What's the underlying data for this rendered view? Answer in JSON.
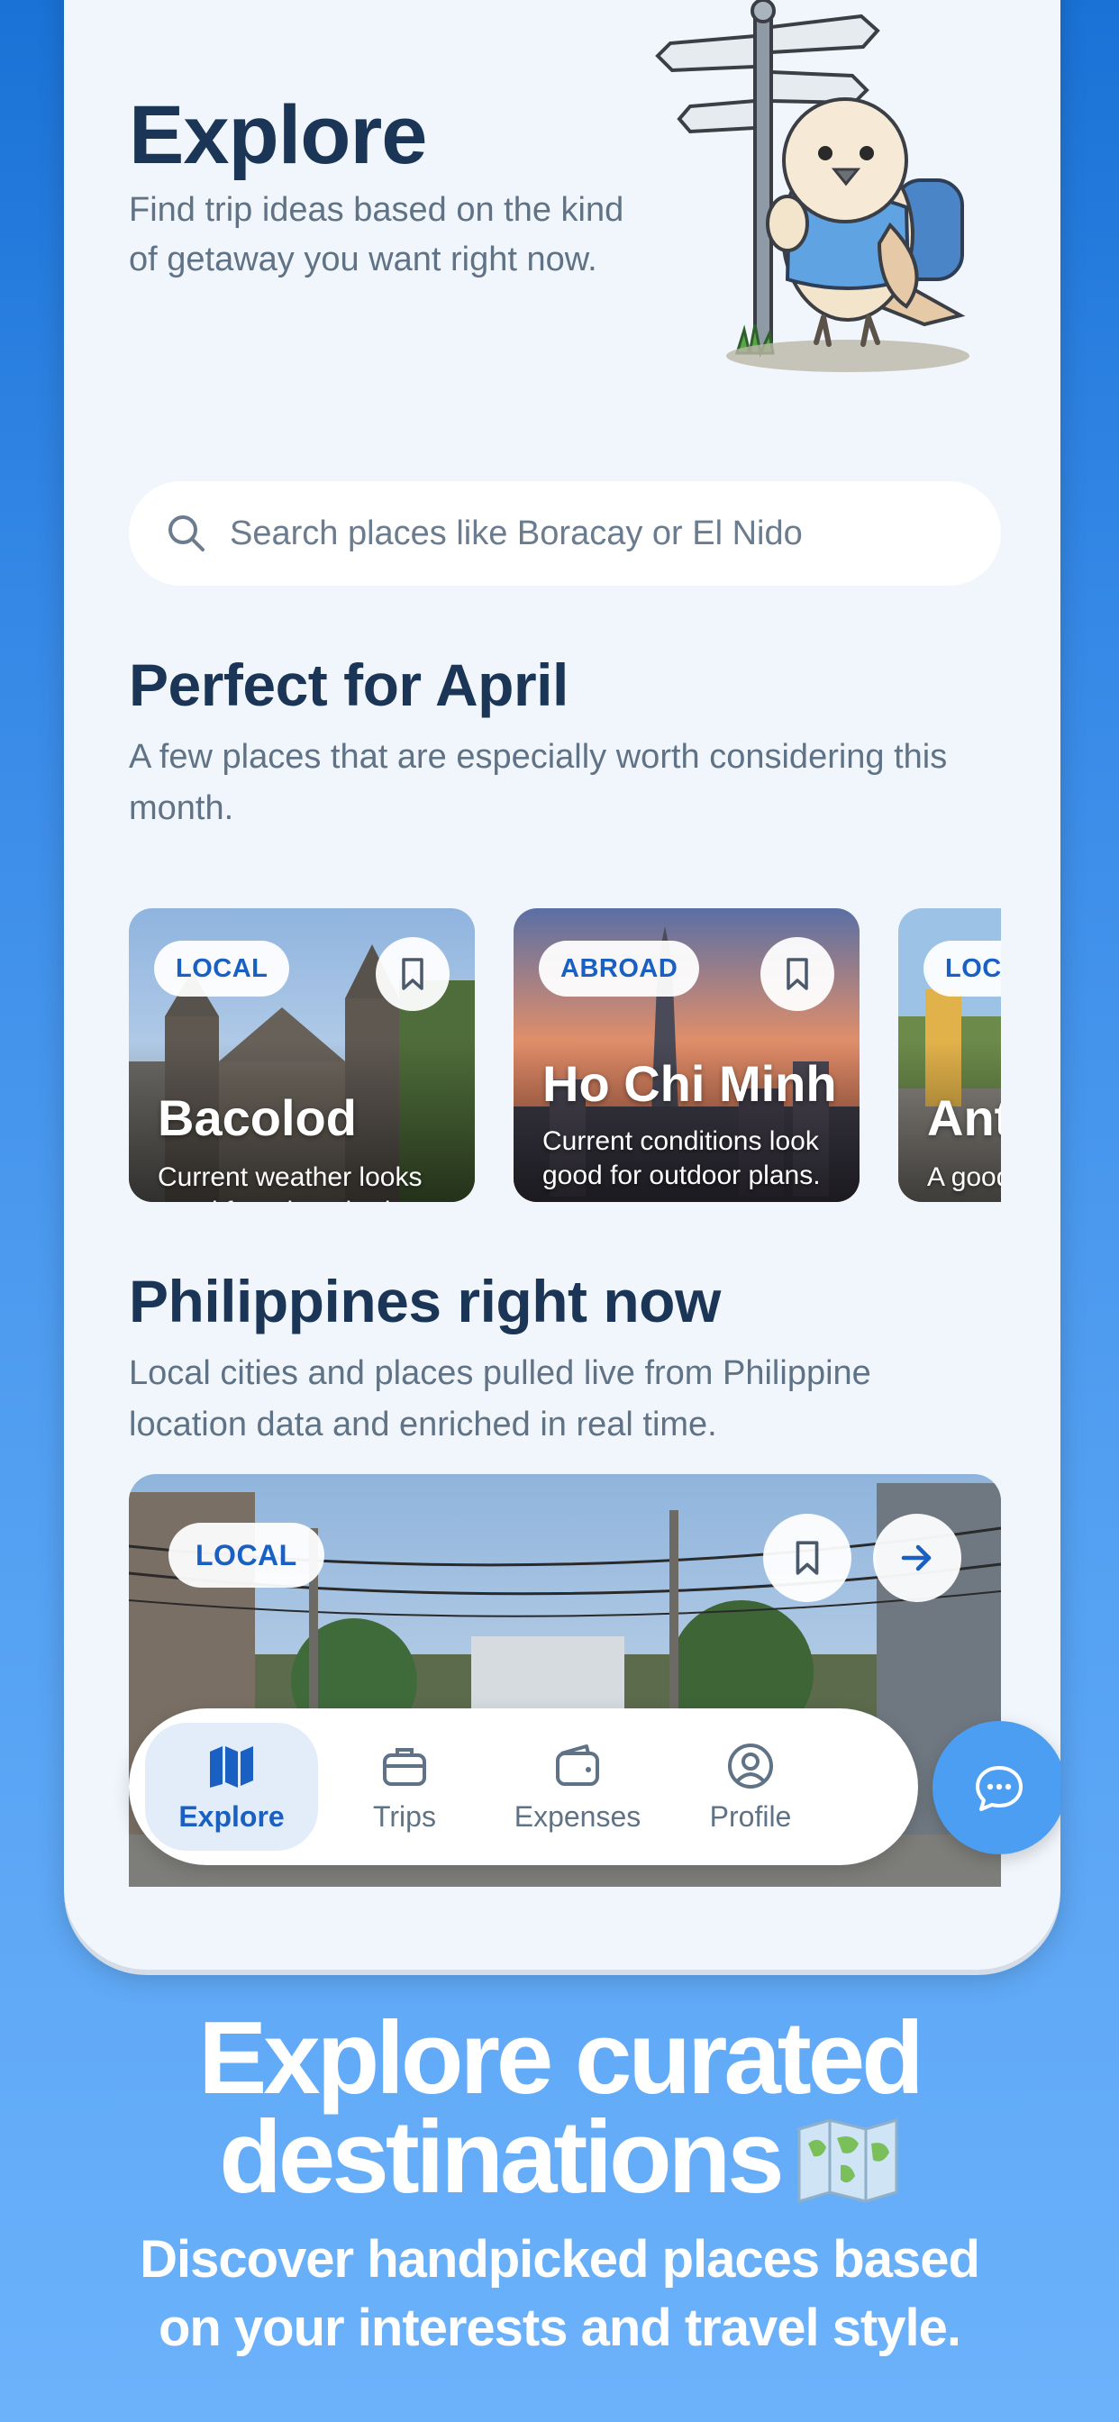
{
  "header": {
    "title": "Explore",
    "subtitle": "Find trip ideas based on the kind of getaway you want right now."
  },
  "search": {
    "placeholder": "Search places like Boracay or El Nido"
  },
  "perfect_section": {
    "title": "Perfect for April",
    "subtitle": "A few places that are especially worth considering this month.",
    "cards": [
      {
        "badge": "LOCAL",
        "title": "Bacolod",
        "desc": "Current weather looks good for a beach trip."
      },
      {
        "badge": "ABROAD",
        "title": "Ho Chi Minh",
        "desc": "Current conditions look good for outdoor plans."
      },
      {
        "badge": "LOCAL",
        "title": "Antipolo",
        "desc": "A good pick for a quick getaway."
      }
    ]
  },
  "ph_section": {
    "title": "Philippines right now",
    "subtitle": "Local cities and places pulled live from Philippine location data and enriched in real time.",
    "card": {
      "badge": "LOCAL"
    }
  },
  "tabbar": {
    "tabs": [
      {
        "label": "Explore",
        "icon": "map-icon",
        "active": true
      },
      {
        "label": "Trips",
        "icon": "briefcase-icon",
        "active": false
      },
      {
        "label": "Expenses",
        "icon": "wallet-icon",
        "active": false
      },
      {
        "label": "Profile",
        "icon": "profile-icon",
        "active": false
      }
    ],
    "chat_icon": "chat-bubble-icon"
  },
  "promo": {
    "title_line1": "Explore curated",
    "title_line2": "destinations",
    "subtitle_line1": "Discover handpicked places based",
    "subtitle_line2": "on your interests and travel style."
  },
  "colors": {
    "accent": "#1a5fc2",
    "heading": "#1b3556",
    "body_text": "#5f7286",
    "screen_bg": "#f1f6fc",
    "fab": "#4b9ef1"
  }
}
